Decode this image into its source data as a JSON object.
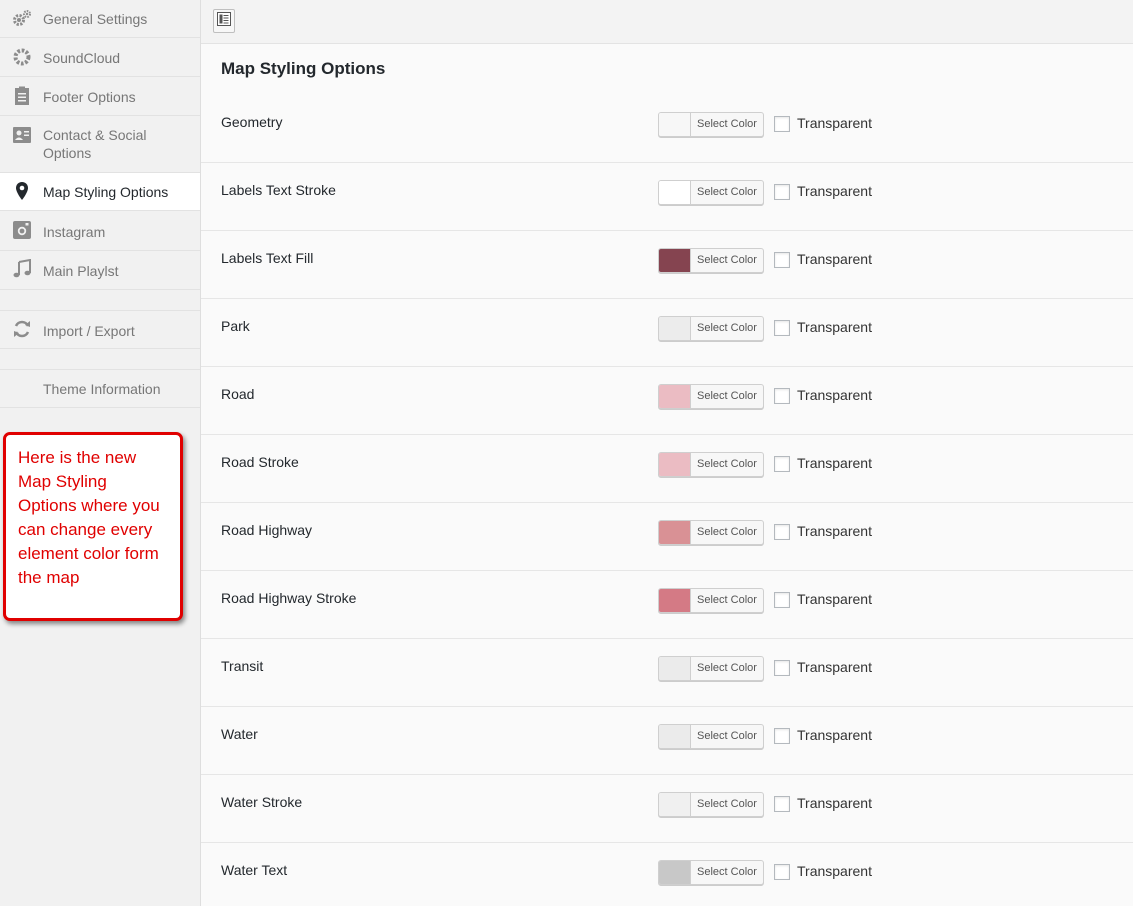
{
  "sidebar": {
    "items": [
      {
        "label": "General Settings",
        "icon": "gears-icon"
      },
      {
        "label": "SoundCloud",
        "icon": "gear-icon"
      },
      {
        "label": "Footer Options",
        "icon": "clipboard-icon"
      },
      {
        "label": "Contact & Social Options",
        "icon": "contact-card-icon"
      },
      {
        "label": "Map Styling Options",
        "icon": "map-pin-icon"
      },
      {
        "label": "Instagram",
        "icon": "instagram-icon"
      },
      {
        "label": "Main Playlst",
        "icon": "music-note-icon"
      },
      {
        "label": "Import / Export",
        "icon": "refresh-icon"
      },
      {
        "label": "Theme Information",
        "icon": ""
      }
    ],
    "active": "Map Styling Options"
  },
  "annotation": {
    "text": "Here is the new Map Styling Options where you can change every element color form the map",
    "color": "#e00000"
  },
  "main": {
    "title": "Map Styling Options",
    "select_color_label": "Select Color",
    "transparent_label": "Transparent",
    "options": [
      {
        "label": "Geometry",
        "color": "#f7f7f7"
      },
      {
        "label": "Labels Text Stroke",
        "color": "#ffffff"
      },
      {
        "label": "Labels Text Fill",
        "color": "#854450"
      },
      {
        "label": "Park",
        "color": "#ececec"
      },
      {
        "label": "Road",
        "color": "#ebbcc3"
      },
      {
        "label": "Road Stroke",
        "color": "#ebbcc3"
      },
      {
        "label": "Road Highway",
        "color": "#d99195"
      },
      {
        "label": "Road Highway Stroke",
        "color": "#d47a85"
      },
      {
        "label": "Transit",
        "color": "#ebebeb"
      },
      {
        "label": "Water",
        "color": "#ebebeb"
      },
      {
        "label": "Water Stroke",
        "color": "#f0f0f0"
      },
      {
        "label": "Water Text",
        "color": "#c8c8c8"
      }
    ]
  }
}
